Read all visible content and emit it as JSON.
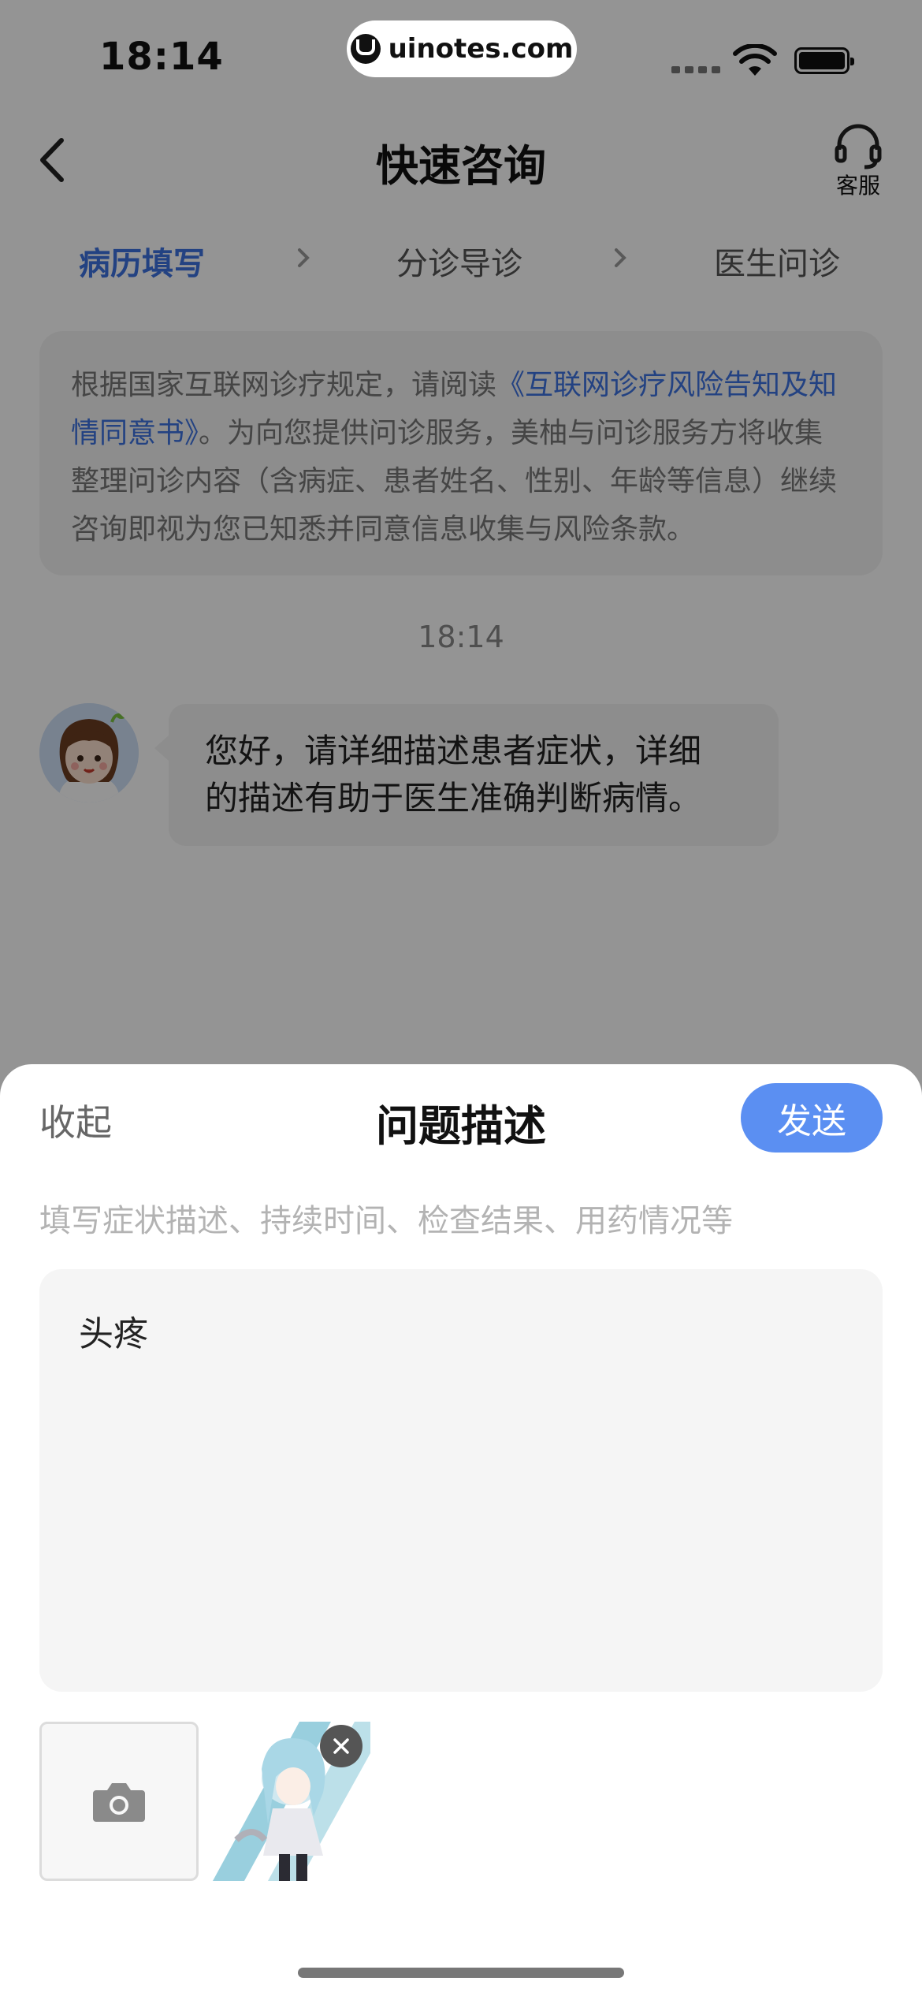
{
  "status_bar": {
    "time": "18:14",
    "watermark": "uinotes.com"
  },
  "nav": {
    "title": "快速咨询",
    "support_label": "客服"
  },
  "steps": [
    {
      "label": "病历填写",
      "active": true
    },
    {
      "label": "分诊导诊",
      "active": false
    },
    {
      "label": "医生问诊",
      "active": false
    }
  ],
  "notice": {
    "prefix": "根据国家互联网诊疗规定，请阅读",
    "link": "《互联网诊疗风险告知及知情同意书》",
    "suffix": "。为向您提供问诊服务，美柚与问诊服务方将收集整理问诊内容（含病症、患者姓名、性别、年龄等信息）继续咨询即视为您已知悉并同意信息收集与风险条款。"
  },
  "chat": {
    "timestamp": "18:14",
    "message_line1": "您好，请详细描述患者症状，详细",
    "message_line2": "的描述有助于医生准确判断病情。"
  },
  "sheet": {
    "collapse_label": "收起",
    "title": "问题描述",
    "send_label": "发送",
    "hint": "填写症状描述、持续时间、检查结果、用药情况等",
    "input_value": "头疼"
  },
  "colors": {
    "accent": "#3d72e0",
    "send_button": "#5b8ff2"
  }
}
